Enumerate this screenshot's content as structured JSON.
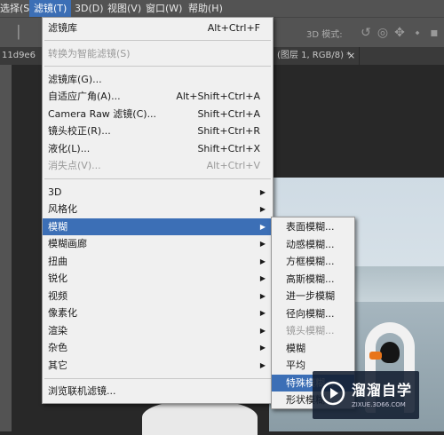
{
  "menubar": {
    "items": [
      {
        "label": "选择(S)",
        "active": false
      },
      {
        "label": "滤镜(T)",
        "active": true
      },
      {
        "label": "3D(D)",
        "active": false
      },
      {
        "label": "视图(V)",
        "active": false
      },
      {
        "label": "窗口(W)",
        "active": false
      },
      {
        "label": "帮助(H)",
        "active": false
      }
    ]
  },
  "toolbar": {
    "mode3d_label": "3D 模式:",
    "icons": [
      "rotate-3d-icon",
      "roll-3d-icon",
      "pan-3d-icon",
      "slide-3d-icon",
      "scale-3d-icon"
    ]
  },
  "tabs": {
    "left_fragment": "11d9e6",
    "active_fragment": "(图层 1, RGB/8) *",
    "close_glyph": "×"
  },
  "filter_menu": {
    "items": [
      {
        "label": "滤镜库",
        "shortcut": "Alt+Ctrl+F"
      },
      {
        "label": "转换为智能滤镜(S)",
        "disabled": true
      },
      {
        "label": "滤镜库(G)..."
      },
      {
        "label": "自适应广角(A)...",
        "shortcut": "Alt+Shift+Ctrl+A"
      },
      {
        "label": "Camera Raw 滤镜(C)...",
        "shortcut": "Shift+Ctrl+A"
      },
      {
        "label": "镜头校正(R)...",
        "shortcut": "Shift+Ctrl+R"
      },
      {
        "label": "液化(L)...",
        "shortcut": "Shift+Ctrl+X"
      },
      {
        "label": "消失点(V)...",
        "shortcut": "Alt+Ctrl+V",
        "disabled": true
      },
      {
        "label": "3D",
        "submenu": true
      },
      {
        "label": "风格化",
        "submenu": true
      },
      {
        "label": "模糊",
        "submenu": true,
        "highlighted": true
      },
      {
        "label": "模糊画廊",
        "submenu": true
      },
      {
        "label": "扭曲",
        "submenu": true
      },
      {
        "label": "锐化",
        "submenu": true
      },
      {
        "label": "视频",
        "submenu": true
      },
      {
        "label": "像素化",
        "submenu": true
      },
      {
        "label": "渲染",
        "submenu": true
      },
      {
        "label": "杂色",
        "submenu": true
      },
      {
        "label": "其它",
        "submenu": true
      },
      {
        "label": "浏览联机滤镜..."
      }
    ],
    "arrow_glyph": "▶"
  },
  "blur_submenu": {
    "items": [
      {
        "label": "表面模糊..."
      },
      {
        "label": "动感模糊..."
      },
      {
        "label": "方框模糊..."
      },
      {
        "label": "高斯模糊..."
      },
      {
        "label": "进一步模糊"
      },
      {
        "label": "径向模糊..."
      },
      {
        "label": "镜头模糊...",
        "disabled": true
      },
      {
        "label": "模糊"
      },
      {
        "label": "平均"
      },
      {
        "label": "特殊模糊...",
        "highlighted": true
      },
      {
        "label": "形状模糊..."
      }
    ]
  },
  "watermark": {
    "title": "溜溜自学",
    "subtitle": "ZIXUE.3D66.COM"
  },
  "colors": {
    "highlight": "#3c6fb6",
    "menu_bg": "#f0f0f0",
    "app_bg": "#535353"
  }
}
